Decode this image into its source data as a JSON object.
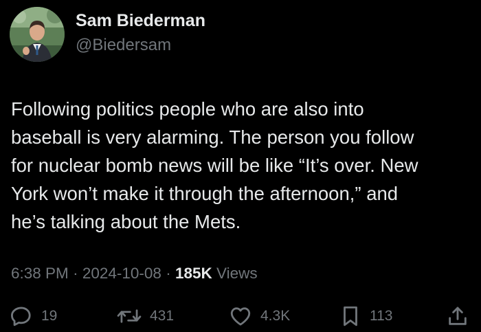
{
  "author": {
    "display_name": "Sam Biederman",
    "handle": "@Biedersam"
  },
  "tweet": {
    "text": "Following politics people who are also into\nbaseball is very alarming. The person you follow\nfor nuclear bomb news will be like “It’s over. New\nYork won’t make it through the afternoon,” and\nhe’s talking about the Mets.",
    "time": "6:38 PM",
    "date": "2024-10-08",
    "separator": "·",
    "views_count": "185K",
    "views_label": "Views"
  },
  "actions": {
    "replies": "19",
    "reposts": "431",
    "likes": "4.3K",
    "bookmarks": "113"
  },
  "icons": {
    "reply": "reply-icon",
    "repost": "repost-icon",
    "like": "heart-icon",
    "bookmark": "bookmark-icon",
    "share": "share-icon"
  },
  "colors": {
    "background": "#000000",
    "primary_text": "#e7e9ea",
    "secondary_text": "#71767b"
  }
}
